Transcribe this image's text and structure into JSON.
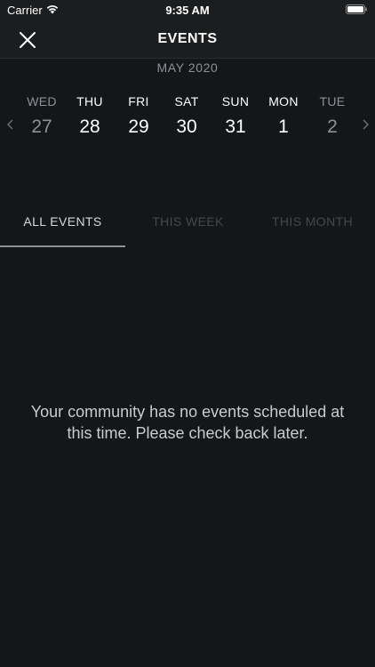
{
  "status_bar": {
    "carrier": "Carrier",
    "time": "9:35 AM",
    "icons": [
      "wifi-icon",
      "battery-icon"
    ]
  },
  "nav": {
    "title": "EVENTS",
    "close_icon": "close-icon"
  },
  "calendar": {
    "month": "MAY 2020",
    "prev_icon": "chevron-left-icon",
    "next_icon": "chevron-right-icon",
    "days": [
      {
        "name": "WED",
        "number": "27",
        "dim": true
      },
      {
        "name": "THU",
        "number": "28",
        "dim": false
      },
      {
        "name": "FRI",
        "number": "29",
        "dim": false
      },
      {
        "name": "SAT",
        "number": "30",
        "dim": false
      },
      {
        "name": "SUN",
        "number": "31",
        "dim": false
      },
      {
        "name": "MON",
        "number": "1",
        "dim": false
      },
      {
        "name": "TUE",
        "number": "2",
        "dim": true
      }
    ]
  },
  "tabs": [
    {
      "label": "ALL EVENTS",
      "active": true
    },
    {
      "label": "THIS WEEK",
      "active": false
    },
    {
      "label": "THIS MONTH",
      "active": false
    }
  ],
  "empty_state": {
    "message": "Your community has no events scheduled at this time. Please check back later."
  },
  "colors": {
    "background": "#14171a",
    "bar_background": "#1b1d1f",
    "text_primary": "#ffffff",
    "text_dim": "#8d9196",
    "tab_inactive": "#44484c"
  }
}
